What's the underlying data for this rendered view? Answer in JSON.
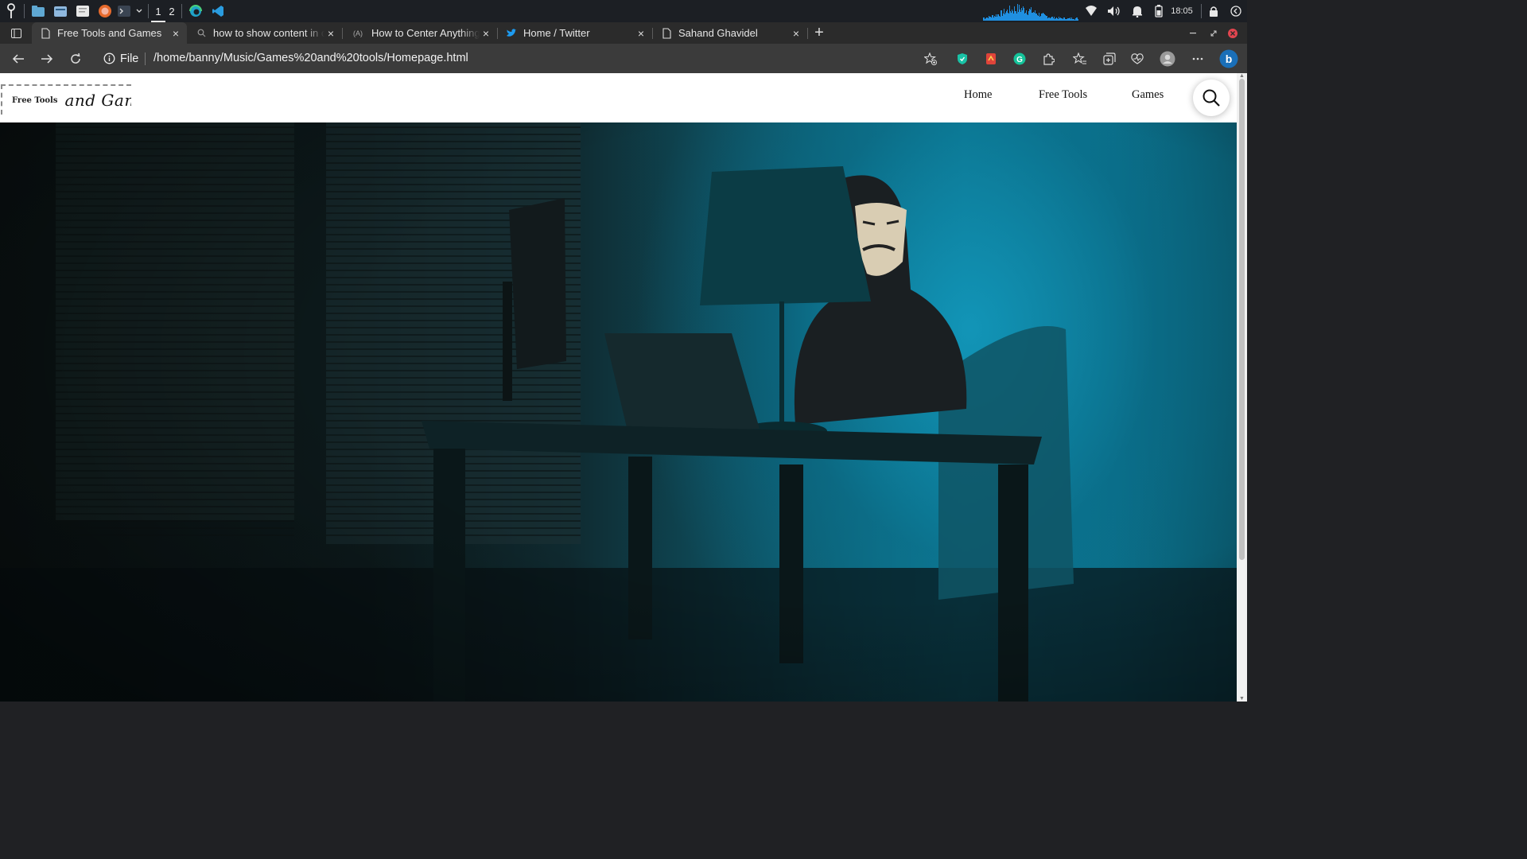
{
  "taskbar": {
    "workspaces": [
      "1",
      "2"
    ],
    "clock": "18:05",
    "icons": [
      "system-menu-icon",
      "file-manager-icon",
      "folder-icon",
      "text-editor-icon",
      "firefox-icon",
      "terminal-icon",
      "chevron-down-icon",
      "edge-icon",
      "vscode-icon",
      "audio-visualizer",
      "wifi-icon",
      "volume-icon",
      "notification-bell-icon",
      "battery-icon",
      "lock-icon",
      "power-icon"
    ]
  },
  "browser": {
    "tabs": [
      {
        "title": "Free Tools and Games",
        "icon": "page-icon",
        "active": true
      },
      {
        "title": "how to show content in c",
        "icon": "search-icon",
        "active": false
      },
      {
        "title": "How to Center Anything w",
        "icon": "translate-icon",
        "active": false
      },
      {
        "title": "Home / Twitter",
        "icon": "twitter-icon",
        "active": false
      },
      {
        "title": "Sahand Ghavidel",
        "icon": "page-icon",
        "active": false
      }
    ],
    "close_glyph": "×",
    "new_tab_glyph": "+",
    "address": {
      "scheme_label": "File",
      "url": "/home/banny/Music/Games%20and%20tools/Homepage.html"
    },
    "toolbar_icons": [
      "star-add-icon",
      "shield-extension-icon",
      "extension-red-icon",
      "grammarly-icon",
      "extensions-icon",
      "favorites-icon",
      "collections-icon",
      "performance-icon",
      "profile-avatar",
      "more-icon",
      "bing-icon"
    ],
    "window_controls": [
      "minimize",
      "maximize",
      "close"
    ]
  },
  "site": {
    "logo": {
      "small": "Free Tools",
      "large": "and Games"
    },
    "nav": [
      "Home",
      "Free Tools",
      "Games"
    ],
    "search_icon": "search-icon",
    "hero_image": "person-in-mask-at-desk-with-laptop-and-lamp"
  },
  "colors": {
    "os_bar": "#1c1f24",
    "tab_strip": "#2b2b2b",
    "toolbar": "#3b3b3b",
    "hero_teal": "#0d7f98",
    "close_red": "#e2454f"
  }
}
